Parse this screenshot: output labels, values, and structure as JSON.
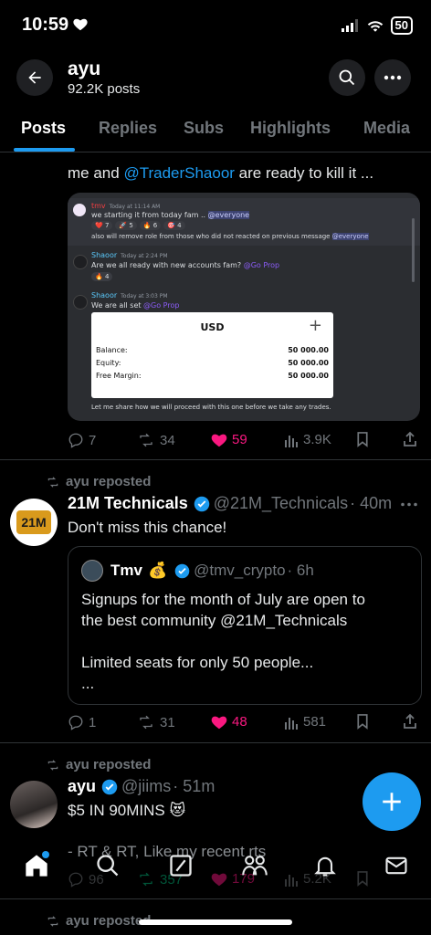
{
  "status": {
    "time": "10:59",
    "battery": "50"
  },
  "header": {
    "name": "ayu",
    "posts_count": "92.2K posts"
  },
  "tabs": [
    "Posts",
    "Replies",
    "Subs",
    "Highlights",
    "Media"
  ],
  "post1": {
    "text_prefix": "me and ",
    "mention": "@TraderShaoor",
    "text_suffix": " are ready to kill it ...",
    "image": {
      "msg1": {
        "name": "tmv",
        "time": "Today at 11:14 AM",
        "line1": "we starting it from today fam .. ",
        "everyone": "@everyone",
        "reactions": [
          "❤️ 7",
          "🚀 5",
          "🔥 6",
          "🎯 4"
        ],
        "line2": "also will remove role from those who did not reacted on previous message ",
        "everyone2": "@everyone"
      },
      "msg2": {
        "name": "Shaoor",
        "time": "Today at 2:24 PM",
        "line": "Are we all ready with new accounts fam? ",
        "mention": "@Go Prop",
        "reaction": "🔥 4"
      },
      "msg3": {
        "name": "Shaoor",
        "time": "Today at 3:03 PM",
        "line": "We are all set ",
        "mention": "@Go Prop"
      },
      "card": {
        "title": "USD",
        "plus": "+",
        "rows": [
          {
            "label": "Balance:",
            "value": "50 000.00"
          },
          {
            "label": "Equity:",
            "value": "50 000.00"
          },
          {
            "label": "Free Margin:",
            "value": "50 000.00"
          }
        ]
      },
      "footer": "Let me share how we will proceed with this one before we take any trades."
    },
    "stats": {
      "replies": "7",
      "reposts": "34",
      "likes": "59",
      "views": "3.9K"
    }
  },
  "post2": {
    "repost_label": "ayu reposted",
    "name": "21M Technicals",
    "handle": "@21M_Technicals",
    "time": "· 40m",
    "text": "Don't miss this chance!",
    "avatar_text": "21M",
    "quote": {
      "name": "Tmv",
      "emoji": "💰",
      "handle": "@tmv_crypto",
      "time": "· 6h",
      "line1": "Signups for the month of July are open to",
      "line2": "the best community @21M_Technicals",
      "line3": "Limited seats for only 50 people...",
      "line4": "..."
    },
    "stats": {
      "replies": "1",
      "reposts": "31",
      "likes": "48",
      "views": "581"
    }
  },
  "post3": {
    "repost_label": "ayu reposted",
    "name": "ayu",
    "handle": "@jiims",
    "time": "· 51m",
    "text": "$5 IN 90MINS 😻",
    "text2": "- RT & RT, Like my recent rts",
    "stats": {
      "replies": "96",
      "reposts": "357",
      "likes": "179",
      "views": "5.2K"
    }
  },
  "post4": {
    "repost_label": "ayu reposted"
  },
  "colors": {
    "accent": "#1d9bf0",
    "like": "#f91880",
    "background": "#000000"
  }
}
